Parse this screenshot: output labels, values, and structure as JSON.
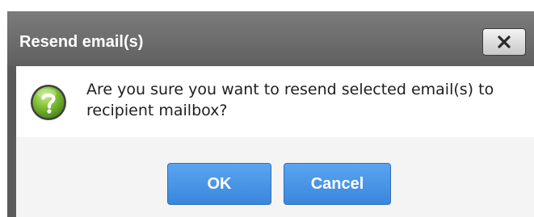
{
  "dialog": {
    "title": "Resend email(s)",
    "close_icon": "close-icon",
    "message_icon": "question-mark-icon",
    "message": "Are you sure you want to resend selected email(s) to recipient mailbox?",
    "ok_label": "OK",
    "cancel_label": "Cancel"
  },
  "colors": {
    "titlebar": "#6e6e6e",
    "button_primary": "#4a96e6",
    "icon_green": "#6aa82a"
  }
}
